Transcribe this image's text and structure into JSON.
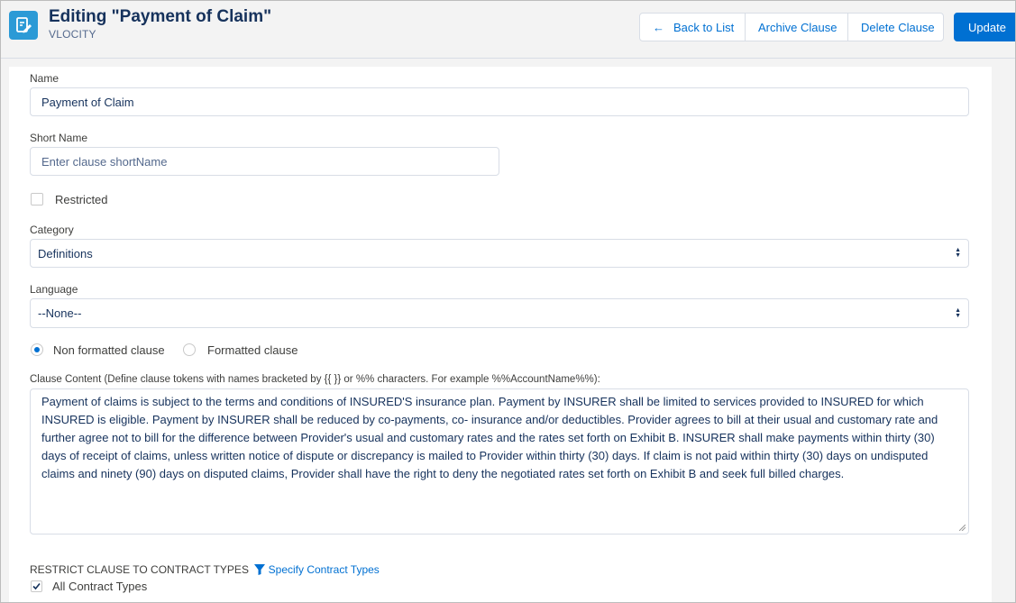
{
  "header": {
    "title": "Editing \"Payment of Claim\"",
    "subtitle": "VLOCITY",
    "icon": "clause-edit-icon",
    "buttons": {
      "back_to_list": "Back to List",
      "archive_clause": "Archive Clause",
      "delete_clause": "Delete Clause",
      "update": "Update"
    },
    "accent_color": "#0070d2"
  },
  "form": {
    "name": {
      "label": "Name",
      "value": "Payment of Claim"
    },
    "short_name": {
      "label": "Short Name",
      "value": "",
      "placeholder": "Enter clause shortName"
    },
    "restricted": {
      "label": "Restricted",
      "checked": false
    },
    "category": {
      "label": "Category",
      "value": "Definitions"
    },
    "language": {
      "label": "Language",
      "value": "--None--"
    },
    "format": {
      "options": [
        "Non formatted clause",
        "Formatted clause"
      ],
      "selected": "Non formatted clause"
    },
    "clause_content": {
      "label": "Clause Content (Define clause tokens with names bracketed by {{ }} or %% characters. For example %%AccountName%%):",
      "value": "Payment of claims is subject to the terms and conditions of INSURED'S insurance plan. Payment by INSURER shall be limited to services provided to INSURED for which INSURED is eligible. Payment by INSURER shall be reduced by co-payments, co- insurance and/or deductibles. Provider agrees to bill at their usual and customary rate and further agree not to bill for the difference between Provider's usual and customary rates and the rates set forth on Exhibit B. INSURER shall make payments within thirty (30) days of receipt of claims, unless written notice of dispute or discrepancy is mailed to Provider within thirty (30) days. If claim is not paid within thirty (30) days on undisputed claims and ninety (90) days on disputed claims, Provider shall have the right to deny the negotiated rates set forth on Exhibit B and seek full billed charges."
    },
    "contract_types": {
      "heading": "RESTRICT CLAUSE TO CONTRACT TYPES",
      "specify_link": "Specify Contract Types",
      "all_label": "All Contract Types",
      "all_checked": true
    }
  }
}
